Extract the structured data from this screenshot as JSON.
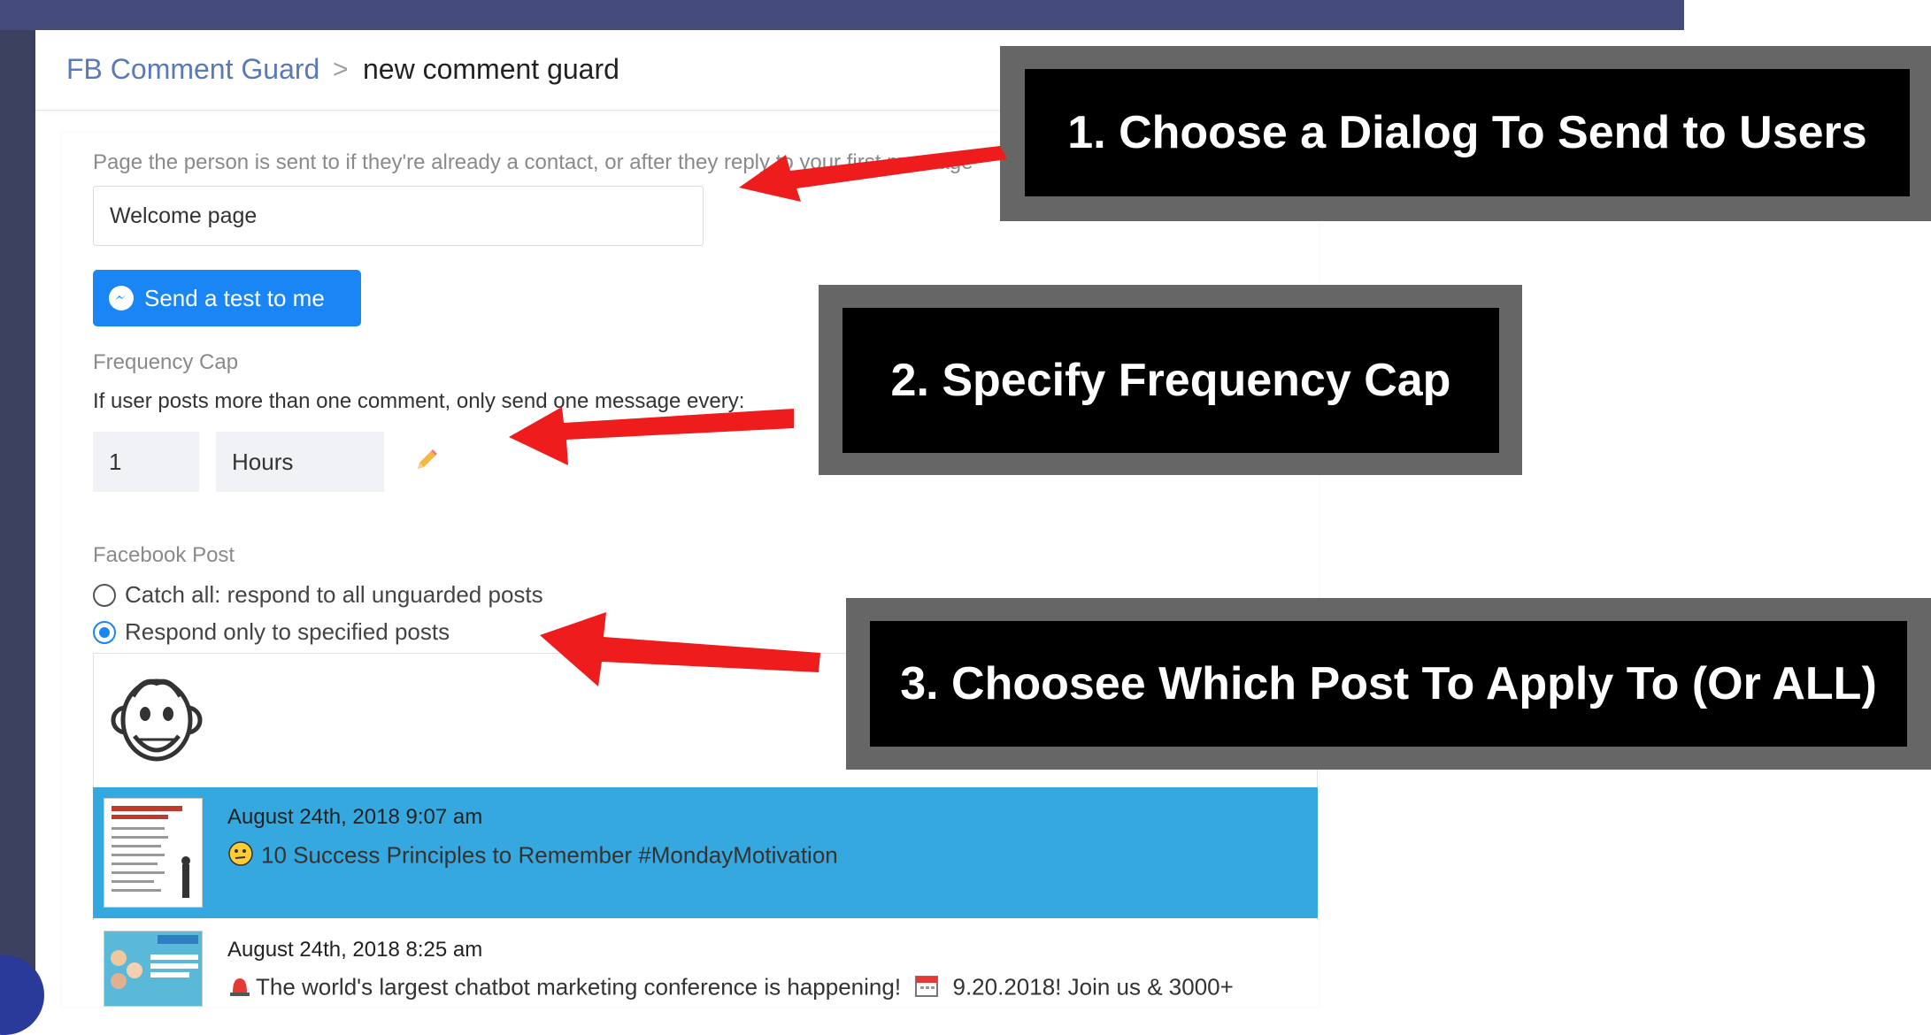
{
  "breadcrumb": {
    "root": "FB Comment Guard",
    "separator": ">",
    "current": "new comment guard"
  },
  "dialog": {
    "label": "Page the person is sent to if they're already a contact, or after they reply to your first message",
    "value": "Welcome page"
  },
  "test_button": {
    "label": "Send a test to me",
    "icon": "messenger-icon"
  },
  "frequency": {
    "label": "Frequency Cap",
    "description": "If user posts more than one comment, only send one message every:",
    "value": "1",
    "unit": "Hours",
    "edit_icon": "pencil-icon"
  },
  "facebook_post": {
    "label": "Facebook Post",
    "options": [
      {
        "label": "Catch all: respond to all unguarded posts",
        "selected": false
      },
      {
        "label": "Respond only to specified posts",
        "selected": true
      }
    ]
  },
  "posts": [
    {
      "date": "August 24th, 2018 9:07 am",
      "text": "10 Success Principles to Remember #MondayMotivation",
      "emoji": "thinking-face",
      "selected": true
    },
    {
      "date": "August 24th, 2018 8:25 am",
      "text": "The world's largest chatbot marketing conference is happening! ",
      "text_after": " 9.20.2018! Join us & 3000+",
      "emoji": "siren",
      "selected": false
    }
  ],
  "callouts": [
    "1. Choose a Dialog To Send to Users",
    "2. Specify Frequency Cap",
    "3. Choosee Which Post To Apply To (Or ALL)"
  ],
  "colors": {
    "accent": "#1a86f5",
    "selected_row": "#35a8e0",
    "arrow": "#ee1c1c",
    "topbar": "#464b7e"
  }
}
